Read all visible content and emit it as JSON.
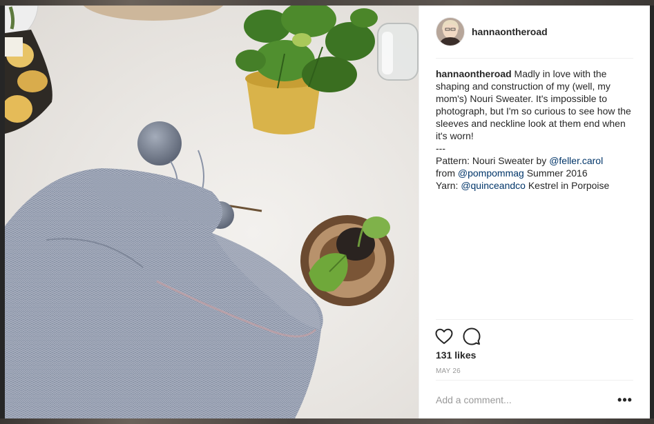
{
  "post": {
    "username": "hannaontheroad",
    "caption_user": "hannaontheroad",
    "caption_text_1": " Madly in love with the shaping and construction of my (well, my mom's) Nouri Sweater. It's impossible to photograph, but I'm so curious to see how the sleeves and neckline look at them end when it's worn!\n---\nPattern: Nouri Sweater by ",
    "mention_1": "@feller.carol",
    "caption_text_2": "\nfrom ",
    "mention_2": "@pompommag",
    "caption_text_3": " Summer 2016\nYarn: ",
    "mention_3": "@quinceandco",
    "caption_text_4": " Kestrel in Porpoise",
    "likes": "131 likes",
    "date": "MAY 26"
  },
  "comment": {
    "placeholder": "Add a comment...",
    "more_label": "•••"
  },
  "icons": {
    "like": "heart-icon",
    "comment": "comment-icon",
    "more": "more-options-icon"
  },
  "colors": {
    "text": "#262626",
    "mention": "#003569",
    "muted": "#999999",
    "divider": "#efefef"
  }
}
